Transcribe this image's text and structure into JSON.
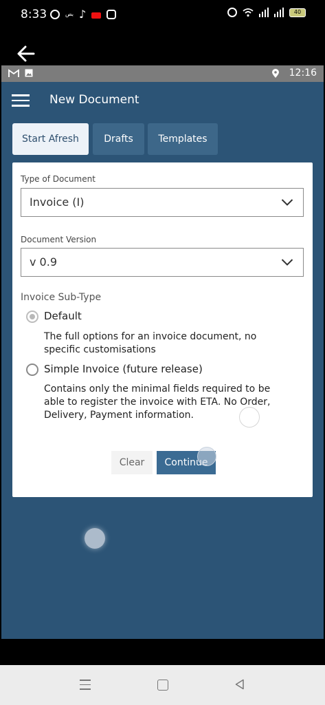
{
  "phone_status": {
    "time": "8:33",
    "app_badge": "بص",
    "battery": "40"
  },
  "emulator_status": {
    "time": "12:16"
  },
  "header": {
    "title": "New Document"
  },
  "tabs": [
    {
      "label": "Start Afresh",
      "active": true
    },
    {
      "label": "Drafts",
      "active": false
    },
    {
      "label": "Templates",
      "active": false
    }
  ],
  "form": {
    "document_type": {
      "label": "Type of Document",
      "value": "Invoice (I)"
    },
    "document_version": {
      "label": "Document Version",
      "value": "v 0.9"
    },
    "sub_type": {
      "label": "Invoice Sub-Type",
      "options": [
        {
          "label": "Default",
          "selected": true,
          "description": "The full options for an invoice document, no specific customisations"
        },
        {
          "label": "Simple Invoice (future release)",
          "selected": false,
          "description": "Contains only the minimal fields required to be able to register the invoice with ETA. No Order, Delivery, Payment information."
        }
      ]
    }
  },
  "buttons": {
    "clear": "Clear",
    "continue": "Continue"
  },
  "colors": {
    "app_background": "#2c5476",
    "primary_button": "#3b6b93",
    "active_tab": "#edf2f8"
  }
}
